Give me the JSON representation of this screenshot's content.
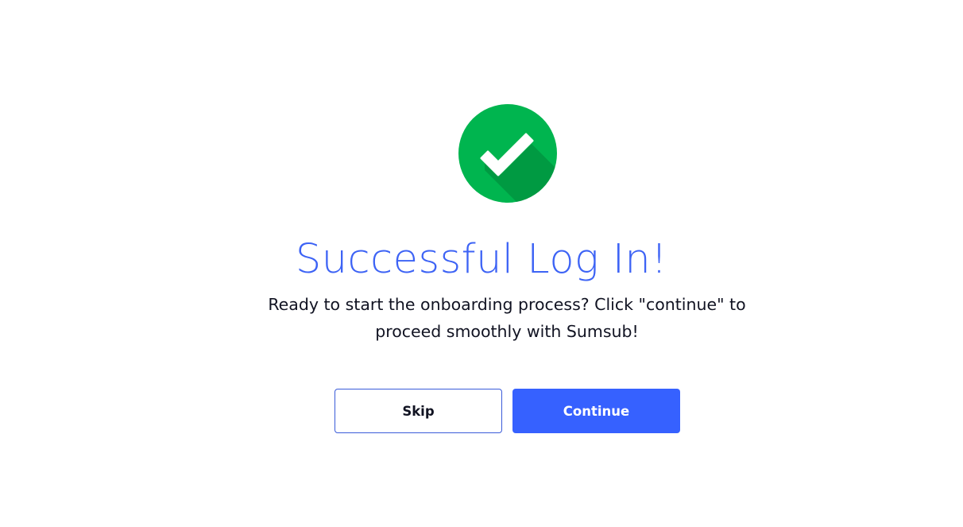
{
  "colors": {
    "success_green": "#00B54F",
    "check_white": "#FFFFFF",
    "check_shadow": "#007A34",
    "title_blue": "#3D63F5",
    "text_dark": "#111322",
    "primary_button_bg": "#3661FF",
    "skip_border": "#3A5BD9"
  },
  "icon": {
    "name": "checkmark-success-icon"
  },
  "title": "Successful Log In!",
  "message": "Ready to start the onboarding process? Click \"continue\" to proceed smoothly with Sumsub!",
  "buttons": {
    "skip_label": "Skip",
    "continue_label": "Continue"
  }
}
